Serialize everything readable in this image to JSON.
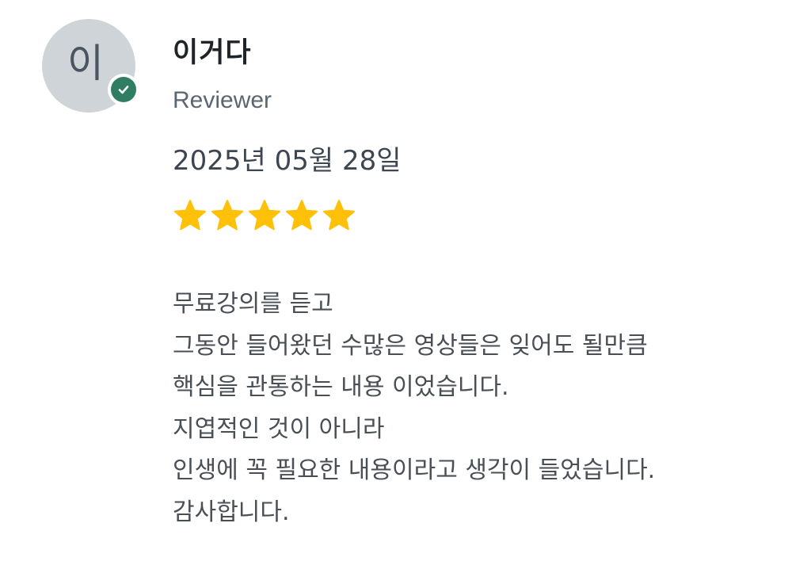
{
  "reviewer": {
    "initial": "이",
    "name": "이거다",
    "role": "Reviewer",
    "verified": true
  },
  "review": {
    "date": "2025년 05월 28일",
    "rating": 5,
    "rating_max": 5,
    "lines": [
      "무료강의를 듣고",
      "그동안 들어왔던 수많은 영상들은 잊어도 될만큼",
      "핵심을 관통하는 내용 이었습니다.",
      "지엽적인 것이 아니라",
      "인생에 꼭 필요한 내용이라고 생각이 들었습니다.",
      "감사합니다."
    ]
  },
  "colors": {
    "avatar_bg": "#cfd4d9",
    "verified_badge": "#2f7d62",
    "star": "#ffc107"
  },
  "icons": {
    "badge": "check-icon",
    "rating": "star-icon"
  }
}
